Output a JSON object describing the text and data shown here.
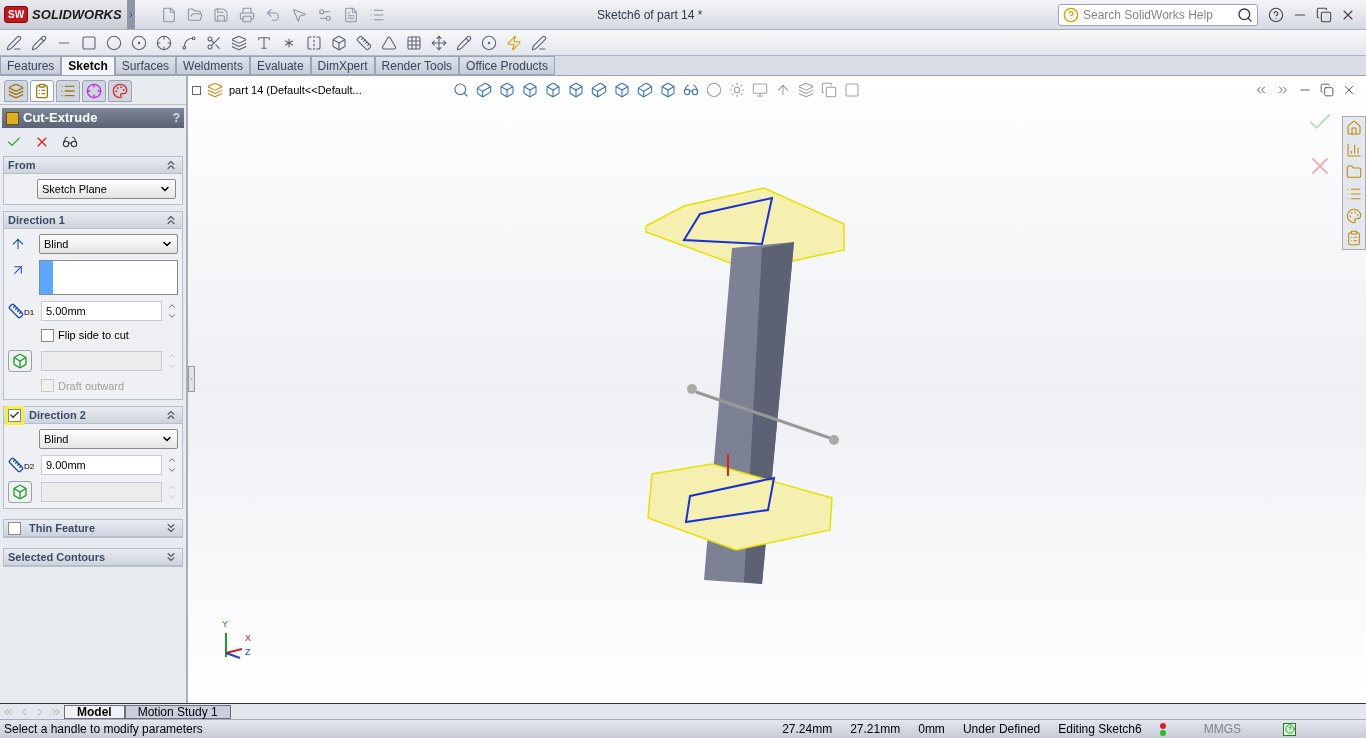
{
  "app": {
    "logo_mark": "SW",
    "logo_text": "SOLIDWORKS"
  },
  "window": {
    "title": "Sketch6 of part 14 *"
  },
  "search": {
    "placeholder": "Search SolidWorks Help"
  },
  "command_tabs": [
    {
      "label": "Features",
      "selected": false
    },
    {
      "label": "Sketch",
      "selected": true
    },
    {
      "label": "Surfaces",
      "selected": false
    },
    {
      "label": "Weldments",
      "selected": false
    },
    {
      "label": "Evaluate",
      "selected": false
    },
    {
      "label": "DimXpert",
      "selected": false
    },
    {
      "label": "Render Tools",
      "selected": false
    },
    {
      "label": "Office Products",
      "selected": false
    }
  ],
  "manager_tabs": [
    {
      "selected": false
    },
    {
      "selected": true
    },
    {
      "selected": false
    },
    {
      "selected": false
    },
    {
      "selected": false
    }
  ],
  "property_manager": {
    "title": "Cut-Extrude",
    "help": "?",
    "from": {
      "title": "From",
      "expanded": true,
      "end_condition": "Sketch Plane"
    },
    "direction_1": {
      "title": "Direction 1",
      "expanded": true,
      "end_condition": "Blind",
      "depth": "5.00mm",
      "depth_label": "D1",
      "flip": {
        "label": "Flip side to cut",
        "checked": false,
        "disabled": false
      },
      "draft": {
        "label": "Draft outward",
        "checked": false,
        "disabled": true
      }
    },
    "direction_2": {
      "title": "Direction 2",
      "checked": true,
      "expanded": true,
      "end_condition": "Blind",
      "depth": "9.00mm",
      "depth_label": "D2"
    },
    "thin_feature": {
      "title": "Thin Feature",
      "checked": false,
      "expanded": false
    },
    "selected_contours": {
      "title": "Selected Contours",
      "expanded": false
    }
  },
  "feature_tree": {
    "label": "part 14  (Default<<Default..."
  },
  "triad": {
    "x": "X",
    "y": "Y",
    "z": "Z"
  },
  "bottom_tabs": [
    {
      "label": "Model",
      "selected": true
    },
    {
      "label": "Motion Study 1",
      "selected": false
    }
  ],
  "status_bar": {
    "message": "Select a handle to modify parameters",
    "fields": [
      "27.24mm",
      "27.21mm",
      "0mm",
      "Under Defined",
      "Editing Sketch6"
    ],
    "units": "MMGS",
    "units_disabled": true
  }
}
